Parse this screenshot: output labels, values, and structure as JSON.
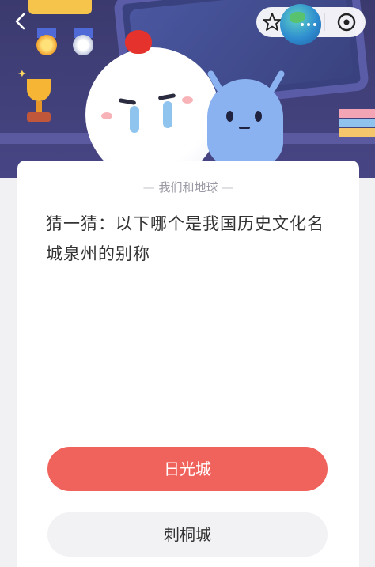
{
  "icons": {
    "back": "chevron-left-icon",
    "favorite": "star-icon",
    "more": "more-dots-icon",
    "close": "close-circle-icon"
  },
  "colors": {
    "correct_option_bg": "#f0635d",
    "option_bg": "#f2f2f5",
    "hero_bg": "#3b3a6e"
  },
  "card": {
    "category": "我们和地球",
    "question": "猜一猜：以下哪个是我国历史文化名城泉州的别称"
  },
  "options": [
    {
      "label": "日光城",
      "state": "selected"
    },
    {
      "label": "刺桐城",
      "state": "default"
    }
  ]
}
